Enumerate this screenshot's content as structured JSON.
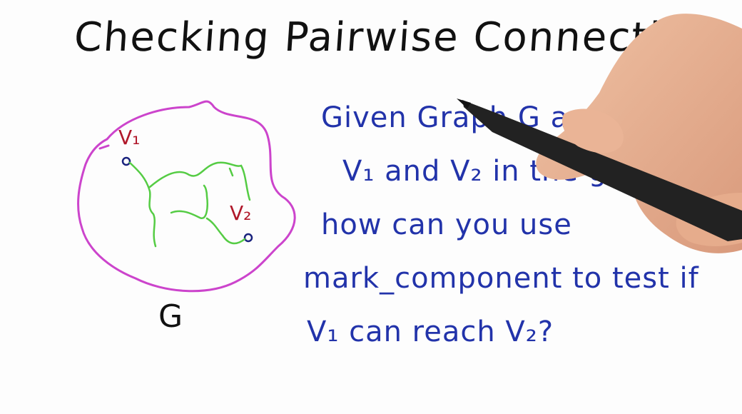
{
  "title": "Checking Pairwise Connectivity",
  "graph": {
    "label": "G",
    "node1_label": "V₁",
    "node2_label": "V₂"
  },
  "question": {
    "line1": "Given Graph G and nodes",
    "line2": "V₁ and V₂ in the graph,",
    "line3": "how can you use",
    "line4": "mark_component to test if",
    "line5": "V₁ can reach V₂?"
  },
  "colors": {
    "ink_black": "#111111",
    "ink_blue": "#2233aa",
    "ink_red": "#b0182a",
    "outline_magenta": "#cc44cc",
    "path_green": "#55cc44"
  }
}
